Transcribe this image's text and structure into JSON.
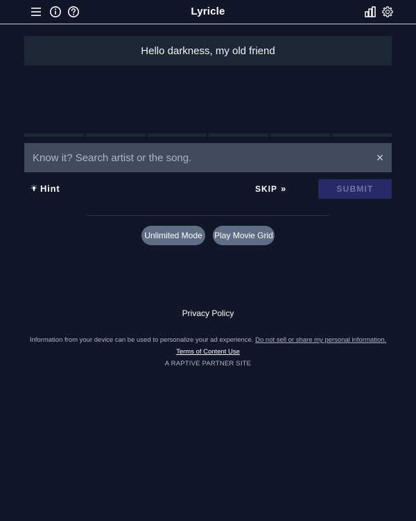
{
  "header": {
    "title": "Lyricle",
    "icons": {
      "menu": "hamburger-menu-icon",
      "info": "info-icon",
      "help": "question-icon",
      "stats": "bar-chart-icon",
      "settings": "gear-icon"
    }
  },
  "lyric": {
    "line": "Hello darkness, my old friend"
  },
  "progress": {
    "segments": 6,
    "revealed": 1
  },
  "search": {
    "placeholder": "Know it? Search artist or the song.",
    "value": "",
    "clear": "✕"
  },
  "actions": {
    "hint_icon": "lightbulb-icon",
    "hint_label": "Hint",
    "skip_label": "SKIP",
    "skip_icon": "»",
    "submit_label": "SUBMIT"
  },
  "modes": {
    "unlimited": "Unlimited Mode",
    "movie_grid": "Play Movie Grid"
  },
  "footer": {
    "privacy": "Privacy Policy",
    "ad_info": "Information from your device can be used to personalize your ad experience.",
    "ad_link": "Do not sell or share my personal information.",
    "terms": "Terms of Content Use",
    "partner": "A RAPTIVE PARTNER SITE"
  },
  "colors": {
    "background": "#121629",
    "panel": "#1d2836",
    "search_bg": "#404b5c",
    "submit_bg": "#272a66",
    "pill_bg": "#606e85"
  }
}
